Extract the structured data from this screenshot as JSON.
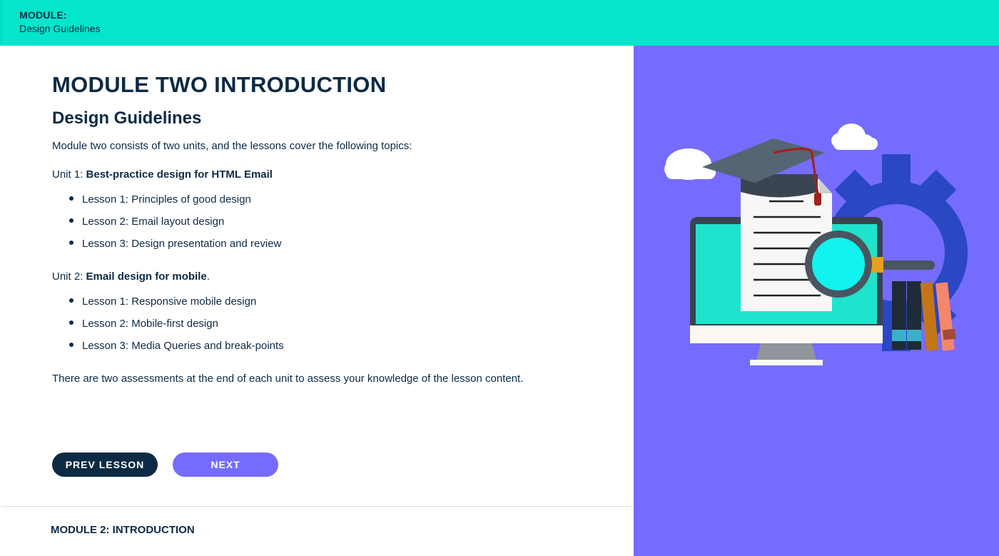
{
  "header": {
    "module_label": "MODULE:",
    "module_name": "Design Guidelines"
  },
  "main": {
    "title": "MODULE TWO INTRODUCTION",
    "subtitle": "Design Guidelines",
    "intro": "Module two consists of two units, and the lessons cover the following topics:",
    "units": [
      {
        "prefix": "Unit 1: ",
        "name": "Best-practice design for HTML Email",
        "suffix": "",
        "lessons": [
          "Lesson 1: Principles of good design",
          "Lesson 2: Email layout design",
          "Lesson 3: Design presentation and review"
        ]
      },
      {
        "prefix": "Unit 2: ",
        "name": "Email design for mobile",
        "suffix": ".",
        "lessons": [
          "Lesson 1: Responsive mobile design",
          "Lesson 2: Mobile-first design",
          "Lesson 3: Media Queries and break-points"
        ]
      }
    ],
    "closing": "There are two assessments at the end of each unit to assess your knowledge of the lesson content."
  },
  "buttons": {
    "prev_label": "PREV LESSON",
    "next_label": "NEXT"
  },
  "footer": {
    "label": "MODULE 2: INTRODUCTION"
  },
  "illustration": {
    "icons": [
      "cloud-icon",
      "graduation-cap-icon",
      "gear-icon",
      "monitor-icon",
      "document-icon",
      "magnifier-icon",
      "books-icon"
    ]
  },
  "colors": {
    "header_bg": "#03e6cb",
    "side_bg": "#756cfe",
    "text": "#0d2a45",
    "prev_button": "#0d2a45",
    "next_button": "#756cfe"
  }
}
